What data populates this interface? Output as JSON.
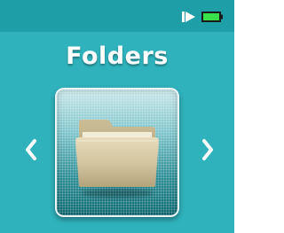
{
  "status_bar": {
    "icons": [
      "play-icon",
      "battery-icon"
    ],
    "battery_color": "#38e04a"
  },
  "menu": {
    "title": "Folders",
    "current_item": "folder-icon",
    "prev_icon": "chevron-left-icon",
    "next_icon": "chevron-right-icon"
  },
  "colors": {
    "background": "#2fb2bc",
    "status_bar": "#1e9fa8",
    "text": "#ffffff",
    "folder": "#d4c6a0"
  }
}
